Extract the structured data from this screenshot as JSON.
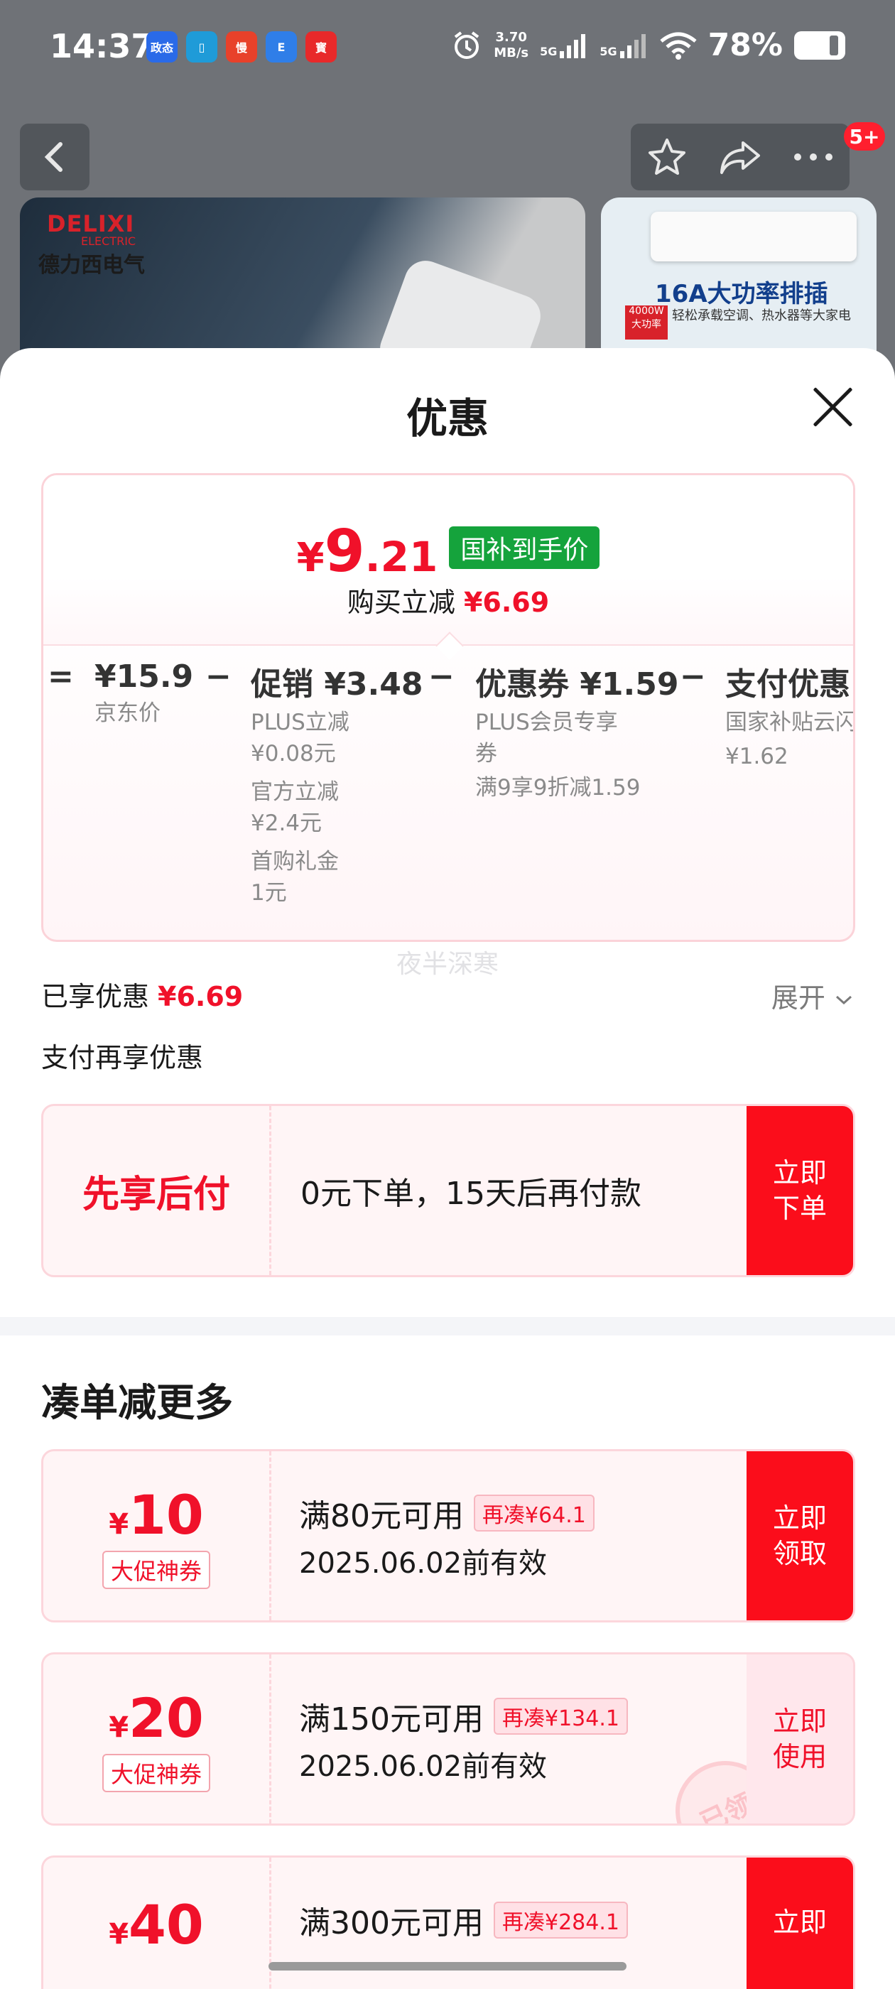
{
  "status_bar": {
    "time": "14:37",
    "apps": [
      {
        "label": "政态",
        "color": "#2a6ae8"
      },
      {
        "label": "▯",
        "color": "#1f9bd8"
      },
      {
        "label": "慢",
        "color": "#e8412a"
      },
      {
        "label": "E",
        "color": "#2f7ee8"
      },
      {
        "label": "寳",
        "color": "#e8292a"
      }
    ],
    "net_speed_value": "3.70",
    "net_speed_unit": "MB/s",
    "signal1": "5G",
    "signal2": "5G",
    "battery": "78%"
  },
  "header": {
    "back_icon": "chevron-left-icon",
    "fav_icon": "star-icon",
    "share_icon": "share-icon",
    "more_icon": "more-dots-icon",
    "message_badge": "5+"
  },
  "products": [
    {
      "logo": "DELIXI",
      "logo_sub": "ELECTRIC",
      "brand_cn": "德力西电气"
    },
    {
      "headline": "16A大功率排插",
      "sub": "轻松承载空调、热水器等大家电",
      "tag": "4000W 大功率"
    }
  ],
  "sheet": {
    "title": "优惠",
    "close_icon": "close-icon"
  },
  "price_card": {
    "currency": "¥",
    "price_int": "9",
    "price_dec": ".21",
    "tag": "国补到手价",
    "buy_less_label": "购买立减",
    "buy_less_value": "¥6.69"
  },
  "calc": {
    "eq": "=",
    "minus": "−",
    "jd_amount": "¥15.9",
    "jd_label": "京东价",
    "promo_amount": "促销 ¥3.48",
    "promo_items": [
      "PLUS立减\n¥0.08元",
      "官方立减\n¥2.4元",
      "首购礼金\n1元"
    ],
    "coupon_amount": "优惠券 ¥1.59",
    "coupon_items": [
      "PLUS会员专享\n券",
      "满9享9折减1.59"
    ],
    "pay_amount": "支付优惠 ¥",
    "pay_items": [
      "国家补贴云闪",
      "¥1.62"
    ]
  },
  "watermark": "夜半深寒",
  "enjoyed": {
    "label": "已享优惠",
    "value": "¥6.69"
  },
  "expand": {
    "label": "展开",
    "icon": "chevron-down-icon"
  },
  "pay_section_title": "支付再享优惠",
  "bnpl": {
    "left": "先享后付",
    "text": "0元下单，15天后再付款",
    "action": "立即\n下单"
  },
  "section2_title": "凑单减更多",
  "coupons": [
    {
      "sym": "¥",
      "value": "10",
      "tag": "大促神券",
      "condition": "满80元可用",
      "more": "再凑¥64.1",
      "expiry": "2025.06.02前有效",
      "action": "立即\n领取",
      "claimed": false
    },
    {
      "sym": "¥",
      "value": "20",
      "tag": "大促神券",
      "condition": "满150元可用",
      "more": "再凑¥134.1",
      "expiry": "2025.06.02前有效",
      "action": "立即\n使用",
      "claimed": true,
      "stamp": "已领"
    },
    {
      "sym": "¥",
      "value": "40",
      "tag": "",
      "condition": "满300元可用",
      "more": "再凑¥284.1",
      "expiry": "",
      "action": "立即",
      "claimed": false
    }
  ],
  "colors": {
    "accent": "#f0112a",
    "green_tag": "#15a33c",
    "action_red": "#fb0d1b"
  }
}
